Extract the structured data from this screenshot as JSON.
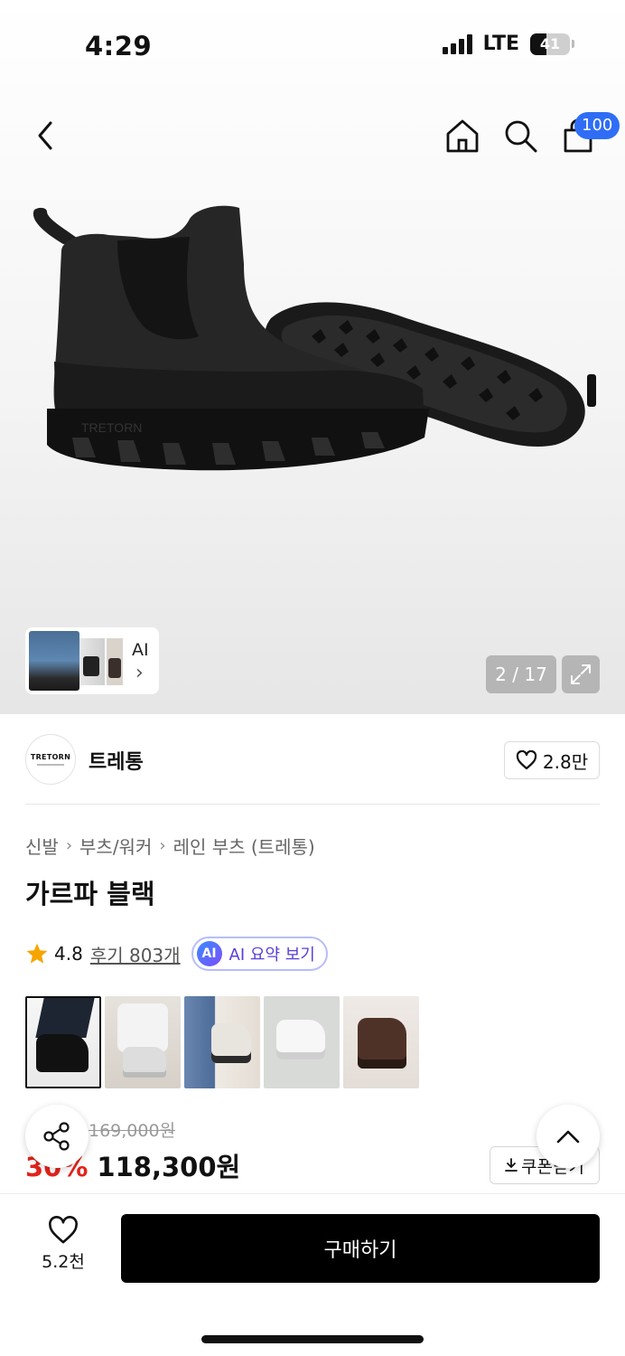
{
  "status_bar": {
    "time": "4:29",
    "network": "LTE",
    "battery": "41",
    "battery_level": 0.41
  },
  "header": {
    "back_icon": "chevron-left-icon",
    "home_icon": "home-icon",
    "search_icon": "search-icon",
    "cart_icon": "shopping-bag-icon",
    "cart_badge": "100",
    "badge_color": "#2f6df6"
  },
  "gallery": {
    "image_logo": "TRETORN",
    "ai_label": "AI",
    "ai_chevron": "›",
    "counter": "2 / 17",
    "expand_icon": "expand-icon"
  },
  "brand": {
    "logo_text": "TRETORN",
    "name": "트레통",
    "likes": "2.8만"
  },
  "breadcrumb": [
    "신발",
    "부츠/워커",
    "레인 부츠 (트레통)"
  ],
  "product": {
    "title": "가르파 블랙",
    "rating": "4.8",
    "reviews": "후기 803개",
    "ai_badge": "AI",
    "ai_summary": "AI 요약 보기",
    "original_price": "169,000원",
    "discount": "30%",
    "price": "118,300원",
    "coupon": "쿠폰받기",
    "discount_color": "#e2231a"
  },
  "bottom_bar": {
    "wish_count": "5.2천",
    "buy_label": "구매하기"
  }
}
